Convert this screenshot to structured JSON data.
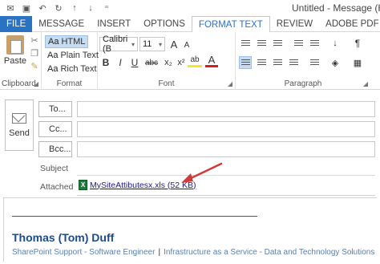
{
  "window": {
    "title": "Untitled - Message (H"
  },
  "quick_access": [
    {
      "icon": "outlook-icon",
      "glyph": "✉"
    },
    {
      "icon": "save-icon",
      "glyph": "▣"
    },
    {
      "icon": "undo-icon",
      "glyph": "↶"
    },
    {
      "icon": "redo-icon",
      "glyph": "↻"
    },
    {
      "icon": "up-arrow-icon",
      "glyph": "↑"
    },
    {
      "icon": "down-arrow-icon",
      "glyph": "↓"
    },
    {
      "icon": "customize-icon",
      "glyph": "⁼"
    }
  ],
  "tabs": [
    "FILE",
    "MESSAGE",
    "INSERT",
    "OPTIONS",
    "FORMAT TEXT",
    "REVIEW",
    "ADOBE PDF"
  ],
  "active_tab": "FORMAT TEXT",
  "ribbon": {
    "clipboard": {
      "label": "Clipboard",
      "paste": "Paste"
    },
    "format": {
      "label": "Format",
      "options": [
        {
          "prefix": "Aa",
          "label": "HTML",
          "selected": true
        },
        {
          "prefix": "Aa",
          "label": "Plain Text",
          "selected": false
        },
        {
          "prefix": "Aa",
          "label": "Rich Text",
          "selected": false
        }
      ]
    },
    "font": {
      "label": "Font",
      "family": "Calibri (B",
      "size": "11",
      "grow": "A",
      "shrink": "A",
      "bold": "B",
      "italic": "I",
      "underline": "U",
      "strike": "abc",
      "subscript": "x₂",
      "superscript": "x²",
      "highlight": "ab",
      "font_color": "A"
    },
    "paragraph": {
      "label": "Paragraph"
    }
  },
  "message": {
    "send": "Send",
    "to": "To...",
    "cc": "Cc...",
    "bcc": "Bcc...",
    "subject_label": "Subject",
    "attached_label": "Attached",
    "attachment": "MySiteAttibutesx.xls (52 KB)"
  },
  "signature": {
    "name": "Thomas (Tom) Duff",
    "role": "SharePoint Support - Software Engineer",
    "separator": "|",
    "team": "Infrastructure as a Service - Data and Technology Solutions"
  },
  "colors": {
    "file_tab": "#2a72c2",
    "signature_name": "#1c4b8c",
    "annotation_arrow": "#d23a3a"
  }
}
